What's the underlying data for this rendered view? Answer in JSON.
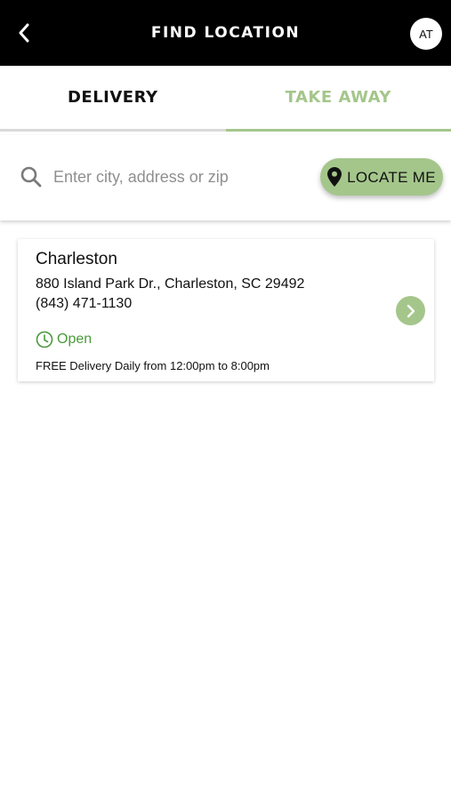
{
  "header": {
    "title": "FIND LOCATION",
    "back_icon": "chevron-left-icon",
    "avatar_initials": "AT"
  },
  "tabs": [
    {
      "label": "DELIVERY",
      "active": false
    },
    {
      "label": "TAKE AWAY",
      "active": true
    }
  ],
  "search": {
    "placeholder": "Enter city, address or zip",
    "value": "",
    "icon": "search-icon",
    "locate_label": "LOCATE ME",
    "locate_icon": "map-pin-icon"
  },
  "locations": [
    {
      "name": "Charleston",
      "address": "880 Island Park Dr., Charleston, SC 29492",
      "phone": "(843) 471-1130",
      "status": "Open",
      "hours": "FREE Delivery Daily from 12:00pm to 8:00pm"
    }
  ],
  "colors": {
    "accent": "#a4c68b",
    "header_bg": "#000000",
    "open_status": "#4a9a3a"
  }
}
